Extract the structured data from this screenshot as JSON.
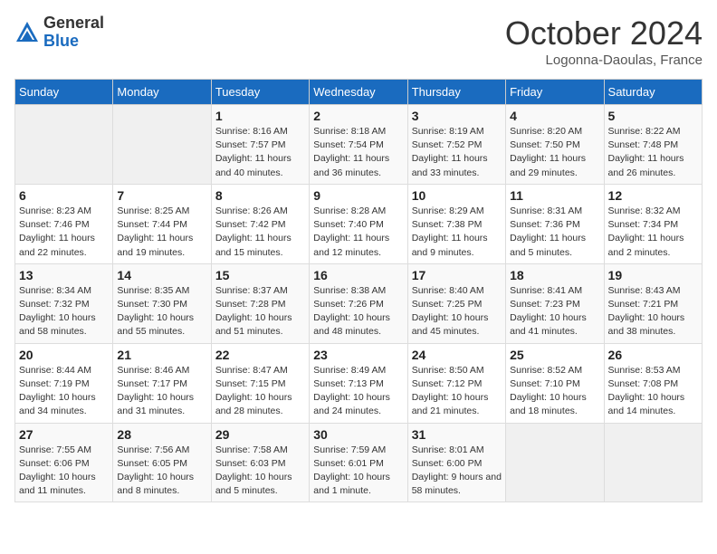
{
  "header": {
    "logo_general": "General",
    "logo_blue": "Blue",
    "month_title": "October 2024",
    "subtitle": "Logonna-Daoulas, France"
  },
  "days_of_week": [
    "Sunday",
    "Monday",
    "Tuesday",
    "Wednesday",
    "Thursday",
    "Friday",
    "Saturday"
  ],
  "weeks": [
    [
      {
        "day": "",
        "info": ""
      },
      {
        "day": "",
        "info": ""
      },
      {
        "day": "1",
        "info": "Sunrise: 8:16 AM\nSunset: 7:57 PM\nDaylight: 11 hours and 40 minutes."
      },
      {
        "day": "2",
        "info": "Sunrise: 8:18 AM\nSunset: 7:54 PM\nDaylight: 11 hours and 36 minutes."
      },
      {
        "day": "3",
        "info": "Sunrise: 8:19 AM\nSunset: 7:52 PM\nDaylight: 11 hours and 33 minutes."
      },
      {
        "day": "4",
        "info": "Sunrise: 8:20 AM\nSunset: 7:50 PM\nDaylight: 11 hours and 29 minutes."
      },
      {
        "day": "5",
        "info": "Sunrise: 8:22 AM\nSunset: 7:48 PM\nDaylight: 11 hours and 26 minutes."
      }
    ],
    [
      {
        "day": "6",
        "info": "Sunrise: 8:23 AM\nSunset: 7:46 PM\nDaylight: 11 hours and 22 minutes."
      },
      {
        "day": "7",
        "info": "Sunrise: 8:25 AM\nSunset: 7:44 PM\nDaylight: 11 hours and 19 minutes."
      },
      {
        "day": "8",
        "info": "Sunrise: 8:26 AM\nSunset: 7:42 PM\nDaylight: 11 hours and 15 minutes."
      },
      {
        "day": "9",
        "info": "Sunrise: 8:28 AM\nSunset: 7:40 PM\nDaylight: 11 hours and 12 minutes."
      },
      {
        "day": "10",
        "info": "Sunrise: 8:29 AM\nSunset: 7:38 PM\nDaylight: 11 hours and 9 minutes."
      },
      {
        "day": "11",
        "info": "Sunrise: 8:31 AM\nSunset: 7:36 PM\nDaylight: 11 hours and 5 minutes."
      },
      {
        "day": "12",
        "info": "Sunrise: 8:32 AM\nSunset: 7:34 PM\nDaylight: 11 hours and 2 minutes."
      }
    ],
    [
      {
        "day": "13",
        "info": "Sunrise: 8:34 AM\nSunset: 7:32 PM\nDaylight: 10 hours and 58 minutes."
      },
      {
        "day": "14",
        "info": "Sunrise: 8:35 AM\nSunset: 7:30 PM\nDaylight: 10 hours and 55 minutes."
      },
      {
        "day": "15",
        "info": "Sunrise: 8:37 AM\nSunset: 7:28 PM\nDaylight: 10 hours and 51 minutes."
      },
      {
        "day": "16",
        "info": "Sunrise: 8:38 AM\nSunset: 7:26 PM\nDaylight: 10 hours and 48 minutes."
      },
      {
        "day": "17",
        "info": "Sunrise: 8:40 AM\nSunset: 7:25 PM\nDaylight: 10 hours and 45 minutes."
      },
      {
        "day": "18",
        "info": "Sunrise: 8:41 AM\nSunset: 7:23 PM\nDaylight: 10 hours and 41 minutes."
      },
      {
        "day": "19",
        "info": "Sunrise: 8:43 AM\nSunset: 7:21 PM\nDaylight: 10 hours and 38 minutes."
      }
    ],
    [
      {
        "day": "20",
        "info": "Sunrise: 8:44 AM\nSunset: 7:19 PM\nDaylight: 10 hours and 34 minutes."
      },
      {
        "day": "21",
        "info": "Sunrise: 8:46 AM\nSunset: 7:17 PM\nDaylight: 10 hours and 31 minutes."
      },
      {
        "day": "22",
        "info": "Sunrise: 8:47 AM\nSunset: 7:15 PM\nDaylight: 10 hours and 28 minutes."
      },
      {
        "day": "23",
        "info": "Sunrise: 8:49 AM\nSunset: 7:13 PM\nDaylight: 10 hours and 24 minutes."
      },
      {
        "day": "24",
        "info": "Sunrise: 8:50 AM\nSunset: 7:12 PM\nDaylight: 10 hours and 21 minutes."
      },
      {
        "day": "25",
        "info": "Sunrise: 8:52 AM\nSunset: 7:10 PM\nDaylight: 10 hours and 18 minutes."
      },
      {
        "day": "26",
        "info": "Sunrise: 8:53 AM\nSunset: 7:08 PM\nDaylight: 10 hours and 14 minutes."
      }
    ],
    [
      {
        "day": "27",
        "info": "Sunrise: 7:55 AM\nSunset: 6:06 PM\nDaylight: 10 hours and 11 minutes."
      },
      {
        "day": "28",
        "info": "Sunrise: 7:56 AM\nSunset: 6:05 PM\nDaylight: 10 hours and 8 minutes."
      },
      {
        "day": "29",
        "info": "Sunrise: 7:58 AM\nSunset: 6:03 PM\nDaylight: 10 hours and 5 minutes."
      },
      {
        "day": "30",
        "info": "Sunrise: 7:59 AM\nSunset: 6:01 PM\nDaylight: 10 hours and 1 minute."
      },
      {
        "day": "31",
        "info": "Sunrise: 8:01 AM\nSunset: 6:00 PM\nDaylight: 9 hours and 58 minutes."
      },
      {
        "day": "",
        "info": ""
      },
      {
        "day": "",
        "info": ""
      }
    ]
  ]
}
